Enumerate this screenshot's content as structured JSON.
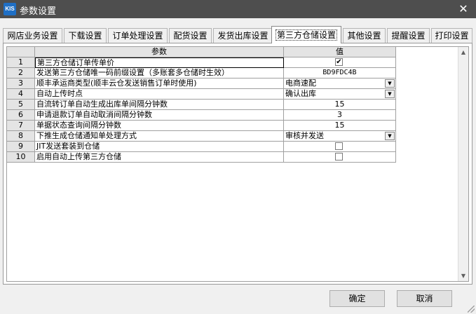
{
  "window": {
    "app_logo": "KIS",
    "title": "参数设置",
    "close_glyph": "✕"
  },
  "tabs": [
    {
      "label": "网店业务设置",
      "active": false
    },
    {
      "label": "下载设置",
      "active": false
    },
    {
      "label": "订单处理设置",
      "active": false
    },
    {
      "label": "配货设置",
      "active": false
    },
    {
      "label": "发货出库设置",
      "active": false
    },
    {
      "label": "第三方仓储设置",
      "active": true
    },
    {
      "label": "其他设置",
      "active": false
    },
    {
      "label": "提醒设置",
      "active": false
    },
    {
      "label": "打印设置",
      "active": false
    }
  ],
  "grid": {
    "headers": {
      "name": "参数",
      "value": "值"
    },
    "rows": [
      {
        "num": "1",
        "name": "第三方仓储订单传单价",
        "type": "checkbox",
        "checked": true
      },
      {
        "num": "2",
        "name": "发送第三方仓储唯一码前缀设置（多账套多仓储时生效）",
        "type": "text",
        "value": "BD9FDC4B"
      },
      {
        "num": "3",
        "name": "顺丰承运商类型(顺丰云仓发送销售订单时使用)",
        "type": "dropdown",
        "value": "电商速配"
      },
      {
        "num": "4",
        "name": "自动上传时点",
        "type": "dropdown",
        "value": "确认出库"
      },
      {
        "num": "5",
        "name": "自流转订单自动生成出库单间隔分钟数",
        "type": "text",
        "value": "15"
      },
      {
        "num": "6",
        "name": "申请退款订单自动取消间隔分钟数",
        "type": "text",
        "value": "3"
      },
      {
        "num": "7",
        "name": "单据状态查询间隔分钟数",
        "type": "text",
        "value": "15"
      },
      {
        "num": "8",
        "name": "下推生成仓储通知单处理方式",
        "type": "dropdown",
        "value": "审核并发送"
      },
      {
        "num": "9",
        "name": "JIT发送套装到仓储",
        "type": "checkbox",
        "checked": false
      },
      {
        "num": "10",
        "name": "启用自动上传第三方仓储",
        "type": "checkbox",
        "checked": false
      }
    ]
  },
  "buttons": {
    "ok": "确定",
    "cancel": "取消"
  },
  "icons": {
    "dropdown_arrow": "▼",
    "check_mark": "✔",
    "scroll_up": "▲",
    "scroll_down": "▼"
  },
  "colors": {
    "titlebar": "#4e4e4e",
    "header_bg": "#e4e4e4",
    "window_bg": "#f0f0f0"
  }
}
